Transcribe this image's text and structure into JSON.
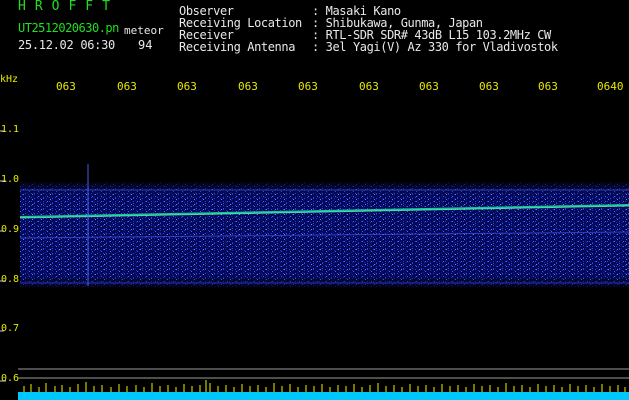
{
  "header": {
    "app_title": "HROFFT",
    "file_name": "UT2512020630.pn",
    "mode": "meteor",
    "date_time": "25.12.02 06:30",
    "counter": "94"
  },
  "station_info": [
    {
      "label": "Observer",
      "value": ": Masaki Kano"
    },
    {
      "label": "Receiving Location",
      "value": ": Shibukawa, Gunma, Japan"
    },
    {
      "label": "Receiver",
      "value": ": RTL-SDR SDR# 43dB L15 103.2MHz CW"
    },
    {
      "label": "Receiving Antenna",
      "value": ": 3el Yagi(V) Az 330 for Vladivostok"
    }
  ],
  "axes": {
    "y_unit": "kHz",
    "y_ticks": [
      "1.1",
      "1.0",
      "0.9",
      "0.8",
      "0.7",
      "0.6"
    ],
    "x_ticks": [
      "063",
      "063",
      "063",
      "063",
      "063",
      "063",
      "063",
      "063",
      "063",
      "0640"
    ]
  },
  "colors": {
    "background": "#000000",
    "title_green": "#22dd22",
    "label_yellow": "#e8e800",
    "text_white": "#e8e8e8",
    "spectrum_blue": "#2a3cff",
    "baseline_cyan": "#00c8ff"
  }
}
